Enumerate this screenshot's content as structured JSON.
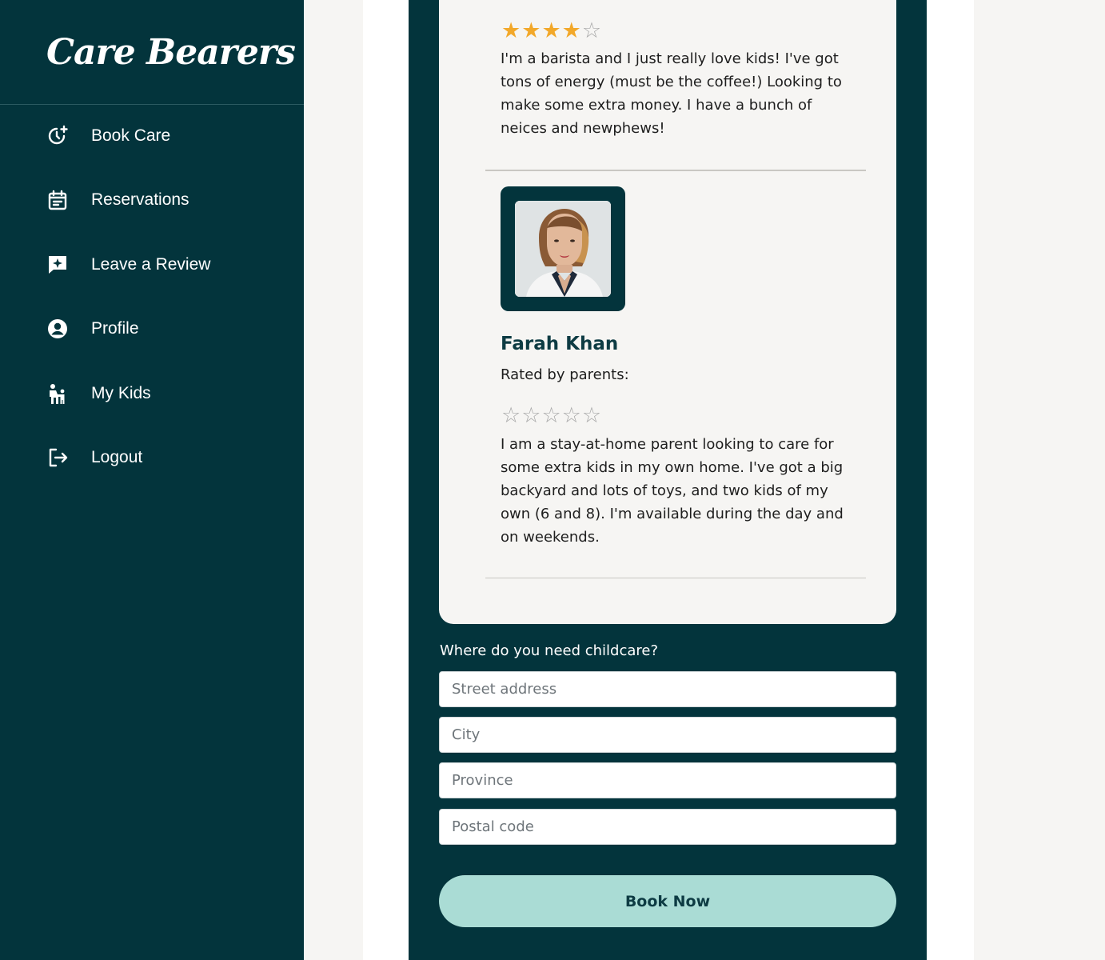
{
  "brand": {
    "name": "Care Bearers"
  },
  "sidebar": {
    "items": [
      {
        "label": "Book Care",
        "icon": "clock-plus-icon"
      },
      {
        "label": "Reservations",
        "icon": "calendar-icon"
      },
      {
        "label": "Leave a Review",
        "icon": "review-sparkle-icon"
      },
      {
        "label": "Profile",
        "icon": "user-circle-icon"
      },
      {
        "label": "My Kids",
        "icon": "parent-child-icon"
      },
      {
        "label": "Logout",
        "icon": "logout-icon"
      }
    ]
  },
  "sitters": [
    {
      "rating": 4,
      "max_rating": 5,
      "bio": "I'm a barista and I just really love kids! I've got tons of energy (must be the coffee!) Looking to make some extra money. I have a bunch of neices and newphews!"
    },
    {
      "name": "Farah Khan",
      "rated_label": "Rated by parents:",
      "rating": 0,
      "max_rating": 5,
      "bio": "I am a stay-at-home parent looking to care for some extra kids in my own home. I've got a big backyard and lots of toys, and two kids of my own (6 and 8). I'm available during the day and on weekends."
    }
  ],
  "booking_form": {
    "prompt": "Where do you need childcare?",
    "street_placeholder": "Street address",
    "city_placeholder": "City",
    "province_placeholder": "Province",
    "postal_placeholder": "Postal code",
    "submit_label": "Book Now"
  },
  "colors": {
    "sidebar_bg": "#03343c",
    "accent_button": "#aadcd5",
    "star_filled": "#f2a82a",
    "star_empty": "#a9a9a9"
  }
}
